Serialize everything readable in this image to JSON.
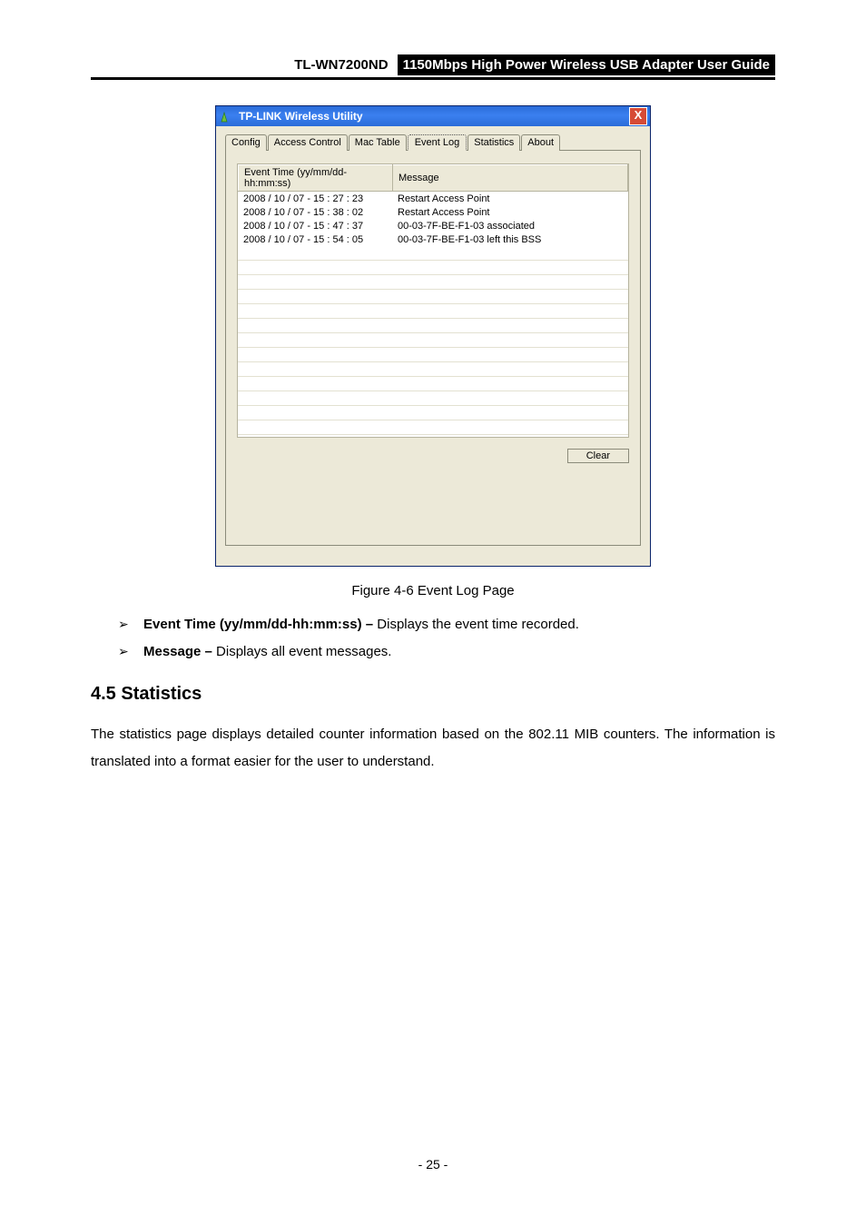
{
  "header": {
    "model": "TL-WN7200ND",
    "title_box": "1",
    "title_rest": "150Mbps High Power Wireless USB Adapter User Guide"
  },
  "window": {
    "title": "TP-LINK Wireless Utility",
    "close_label": "X",
    "tabs": {
      "config": "Config",
      "access_control": "Access Control",
      "mac_table": "Mac Table",
      "event_log": "Event Log",
      "statistics": "Statistics",
      "about": "About"
    },
    "columns": {
      "time": "Event Time (yy/mm/dd- hh:mm:ss)",
      "message": "Message"
    },
    "rows": [
      {
        "time": "2008 / 10 / 07 - 15 : 27 : 23",
        "message": "Restart Access Point"
      },
      {
        "time": "2008 / 10 / 07 - 15 : 38 : 02",
        "message": "Restart Access Point"
      },
      {
        "time": "2008 / 10 / 07 - 15 : 47 : 37",
        "message": "00-03-7F-BE-F1-03 associated"
      },
      {
        "time": "2008 / 10 / 07 - 15 : 54 : 05",
        "message": "00-03-7F-BE-F1-03 left this BSS"
      }
    ],
    "clear_label": "Clear"
  },
  "caption": "Figure 4-6 Event Log Page",
  "bullets": [
    {
      "strong": "Event Time (yy/mm/dd-hh:mm:ss) – ",
      "rest": "Displays the event time recorded."
    },
    {
      "strong": "Message – ",
      "rest": "Displays all event messages."
    }
  ],
  "section": {
    "heading": "4.5  Statistics",
    "body": "The statistics page displays detailed counter information based on the 802.11 MIB counters. The information is translated into a format easier for the user to understand."
  },
  "footer": "- 25 -"
}
